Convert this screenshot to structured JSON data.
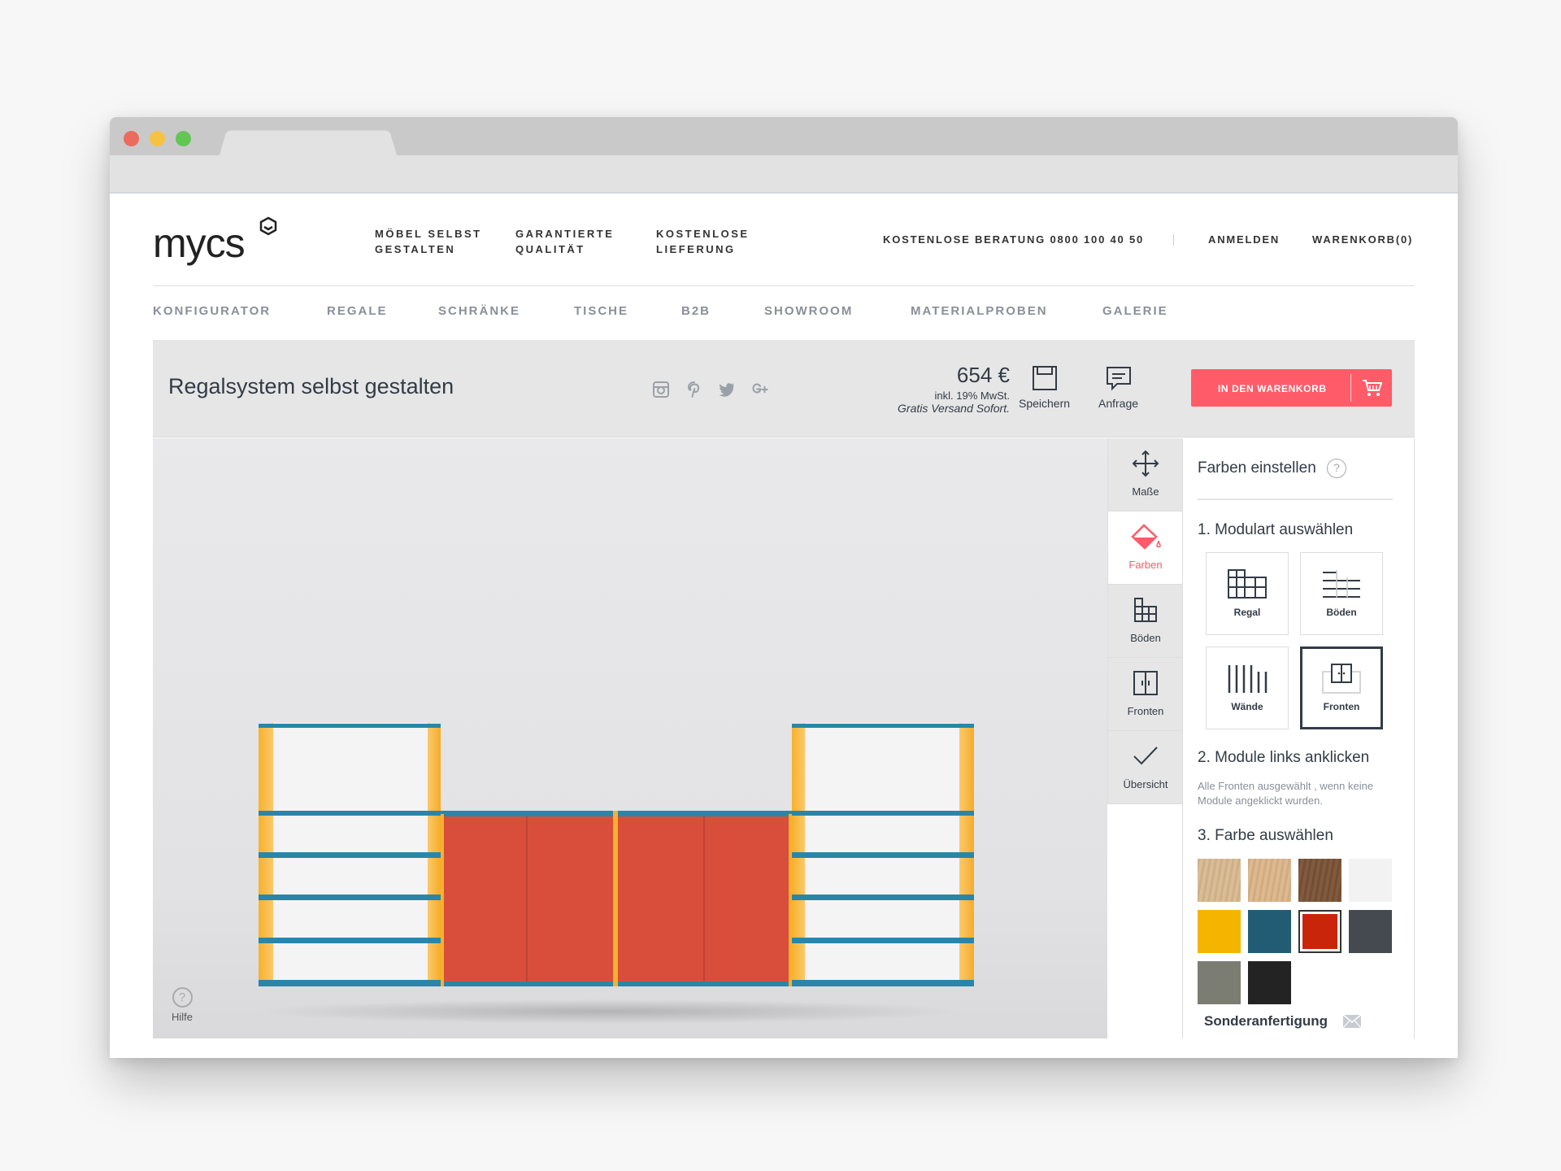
{
  "brand": {
    "logo": "mycs"
  },
  "top_nav": [
    {
      "line1": "MÖBEL SELBST",
      "line2": "GESTALTEN"
    },
    {
      "line1": "GARANTIERTE",
      "line2": "QUALITÄT"
    },
    {
      "line1": "KOSTENLOSE",
      "line2": "LIEFERUNG"
    }
  ],
  "header_right": {
    "hotline": "KOSTENLOSE BERATUNG 0800 100 40 50",
    "login": "ANMELDEN",
    "cart": "WARENKORB(0)"
  },
  "main_nav": [
    "KONFIGURATOR",
    "REGALE",
    "SCHRÄNKE",
    "TISCHE",
    "B2B",
    "SHOWROOM",
    "MATERIALPROBEN",
    "GALERIE"
  ],
  "product": {
    "title": "Regalsystem selbst gestalten",
    "price": "654 €",
    "vat": "inkl. 19% MwSt.",
    "shipping": "Gratis Versand Sofort.",
    "save_label": "Speichern",
    "inquiry_label": "Anfrage",
    "add_to_cart": "IN DEN WARENKORB"
  },
  "social_icons": [
    "instagram-icon",
    "pinterest-icon",
    "twitter-icon",
    "google-plus-icon"
  ],
  "viewer": {
    "help_label": "Hilfe"
  },
  "tools": [
    {
      "label": "Maße",
      "icon": "move-arrows-icon",
      "active": false
    },
    {
      "label": "Farben",
      "icon": "paint-bucket-icon",
      "active": true
    },
    {
      "label": "Böden",
      "icon": "shelves-grid-icon",
      "active": false
    },
    {
      "label": "Fronten",
      "icon": "cabinet-doors-icon",
      "active": false
    },
    {
      "label": "Übersicht",
      "icon": "checkmark-icon",
      "active": false
    }
  ],
  "panel": {
    "title": "Farben einstellen",
    "help": "?",
    "step1": "1. Modulart auswählen",
    "modules": [
      {
        "label": "Regal",
        "selected": false
      },
      {
        "label": "Böden",
        "selected": false
      },
      {
        "label": "Wände",
        "selected": false
      },
      {
        "label": "Fronten",
        "selected": true
      }
    ],
    "step2": "2. Module links anklicken",
    "hint": "Alle Fronten ausgewählt , wenn keine Module angeklickt wurden.",
    "step3": "3. Farbe auswählen",
    "swatches": [
      "#d9b98f",
      "#dcb489",
      "#7a5236",
      "#f2f2f2",
      "#f5b400",
      "#225b74",
      "#c8250b",
      "#454950",
      "#7b7d73",
      "#232323"
    ],
    "selected_swatch": 6,
    "custom_order": "Sonderanfertigung"
  },
  "colors": {
    "accent": "#ff5b68",
    "shelf_blue": "#2a86a8",
    "side_yellow": "#f7b731",
    "front_red": "#d84e3a"
  }
}
